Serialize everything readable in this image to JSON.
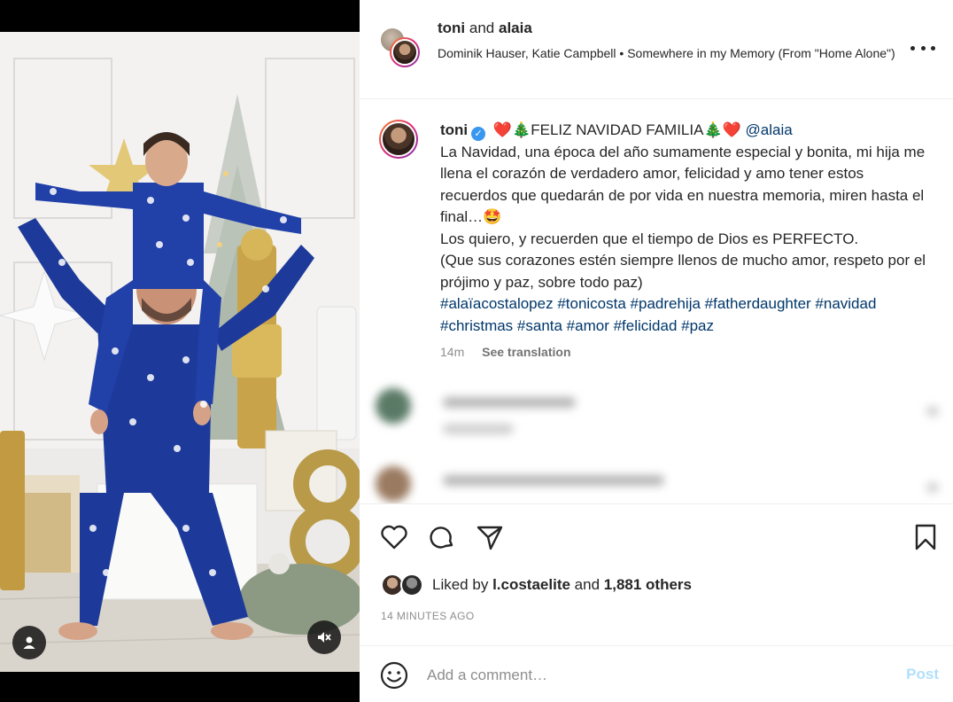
{
  "header": {
    "user1": "toni",
    "joiner": "and",
    "user2": "alaia",
    "audio": "Dominik Hauser, Katie Campbell • Somewhere in my Memory (From \"Home Alone\")",
    "more_icon": "more-horizontal-icon"
  },
  "caption": {
    "username": "toni",
    "verified_icon": "verified-badge-icon",
    "headline": "❤️🎄FELIZ NAVIDAD FAMILIA🎄❤️",
    "mention": "@alaia",
    "paragraph1": "La Navidad, una época del año sumamente especial y bonita, mi hija me llena el corazón de verdadero amor, felicidad y amo tener estos recuerdos que quedarán de por vida en nuestra memoria, miren hasta el final…🤩",
    "paragraph2": "Los quiero, y recuerden que el tiempo de Dios es PERFECTO.",
    "paragraph3": "(Que sus corazones estén siempre llenos de mucho amor, respeto por el prójimo y paz, sobre todo paz)",
    "hashtags": "#alaïacostalopez #tonicosta #padrehija #fatherdaughter #navidad #christmas #santa #amor #felicidad #paz",
    "time": "14m",
    "see_translation": "See translation"
  },
  "actions": {
    "like_icon": "heart-icon",
    "comment_icon": "comment-bubble-icon",
    "share_icon": "paper-plane-icon",
    "save_icon": "bookmark-icon"
  },
  "likes": {
    "prefix": "Liked by",
    "user": "l.costaelite",
    "and": "and",
    "others": "1,881 others"
  },
  "timestamp": "14 MINUTES AGO",
  "comment_box": {
    "emoji_icon": "smiley-icon",
    "placeholder": "Add a comment…",
    "post_label": "Post"
  },
  "media": {
    "user_tag_icon": "user-tag-icon",
    "mute_icon": "speaker-muted-icon"
  },
  "colors": {
    "link": "#00376b",
    "verified": "#3897f0",
    "post_disabled": "#b2dffc",
    "pajama_blue": "#1d3a9a"
  }
}
